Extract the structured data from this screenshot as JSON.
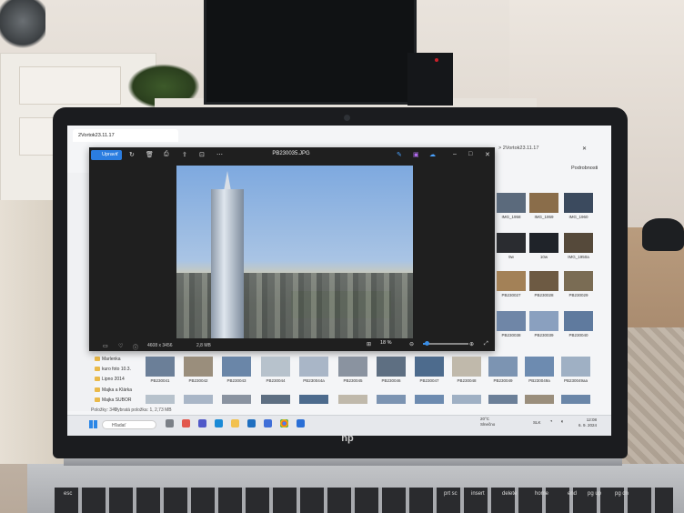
{
  "explorer": {
    "tab_title": "2Vortok23.11.17",
    "breadcrumb_tail": "> 2Vortok23.11.17",
    "sort_label": "Podrobnosti",
    "sidebar_items": [
      "Marlenka",
      "kuro foto 10.3.",
      "Lipno 2014",
      "Majka a Klárka",
      "Majka SUBOR"
    ],
    "status_items": "Položky: 340",
    "status_selected": "Vybratá položka: 1, 2,73 MB",
    "thumb_labels_right": [
      "IMG_1958",
      "IMG_1959",
      "IMG_1960",
      "9w",
      "10w",
      "IMG_1950a",
      "PB230027",
      "PB230028",
      "PB230029",
      "PB230038",
      "PB230039",
      "PB230040"
    ],
    "thumb_labels_bottom": [
      "PB230041",
      "PB230042",
      "PB230043",
      "PB230044",
      "PB230044a",
      "PB230045",
      "PB230046",
      "PB230047",
      "PB230048",
      "PB230049",
      "PB230049a",
      "PB230049aa"
    ]
  },
  "viewer": {
    "title": "PB230035.JPG",
    "edit_label": "Upraviť",
    "dimensions": "4608 x 3456",
    "file_size": "2,8 MB",
    "zoom": "18 %",
    "zoom_fraction": 0.08
  },
  "taskbar": {
    "search_placeholder": "Hľadať",
    "weather_temp": "20°C",
    "weather_desc": "Slnečno",
    "lang": "SLK",
    "time": "12:08",
    "date": "6. 9. 2024"
  },
  "laptop": {
    "brand": "hp"
  },
  "keyboard": {
    "labels": [
      "esc",
      "home",
      "end",
      "pg up",
      "pg dn",
      "delete",
      "prt sc",
      "insert"
    ]
  }
}
